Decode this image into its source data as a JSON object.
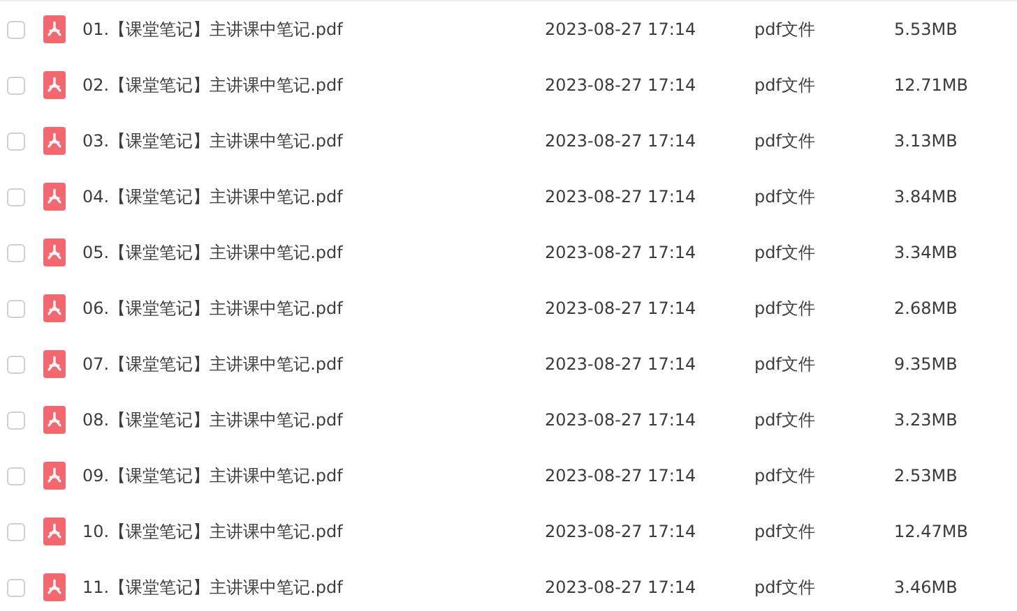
{
  "files": [
    {
      "name": "01.【课堂笔记】主讲课中笔记.pdf",
      "date": "2023-08-27 17:14",
      "type": "pdf文件",
      "size": "5.53MB",
      "checked": false
    },
    {
      "name": "02.【课堂笔记】主讲课中笔记.pdf",
      "date": "2023-08-27 17:14",
      "type": "pdf文件",
      "size": "12.71MB",
      "checked": false
    },
    {
      "name": "03.【课堂笔记】主讲课中笔记.pdf",
      "date": "2023-08-27 17:14",
      "type": "pdf文件",
      "size": "3.13MB",
      "checked": false
    },
    {
      "name": "04.【课堂笔记】主讲课中笔记.pdf",
      "date": "2023-08-27 17:14",
      "type": "pdf文件",
      "size": "3.84MB",
      "checked": false
    },
    {
      "name": "05.【课堂笔记】主讲课中笔记.pdf",
      "date": "2023-08-27 17:14",
      "type": "pdf文件",
      "size": "3.34MB",
      "checked": false
    },
    {
      "name": "06.【课堂笔记】主讲课中笔记.pdf",
      "date": "2023-08-27 17:14",
      "type": "pdf文件",
      "size": "2.68MB",
      "checked": false
    },
    {
      "name": "07.【课堂笔记】主讲课中笔记.pdf",
      "date": "2023-08-27 17:14",
      "type": "pdf文件",
      "size": "9.35MB",
      "checked": false
    },
    {
      "name": "08.【课堂笔记】主讲课中笔记.pdf",
      "date": "2023-08-27 17:14",
      "type": "pdf文件",
      "size": "3.23MB",
      "checked": false
    },
    {
      "name": "09.【课堂笔记】主讲课中笔记.pdf",
      "date": "2023-08-27 17:14",
      "type": "pdf文件",
      "size": "2.53MB",
      "checked": false
    },
    {
      "name": "10.【课堂笔记】主讲课中笔记.pdf",
      "date": "2023-08-27 17:14",
      "type": "pdf文件",
      "size": "12.47MB",
      "checked": false
    },
    {
      "name": "11.【课堂笔记】主讲课中笔记.pdf",
      "date": "2023-08-27 17:14",
      "type": "pdf文件",
      "size": "3.46MB",
      "checked": false
    }
  ]
}
